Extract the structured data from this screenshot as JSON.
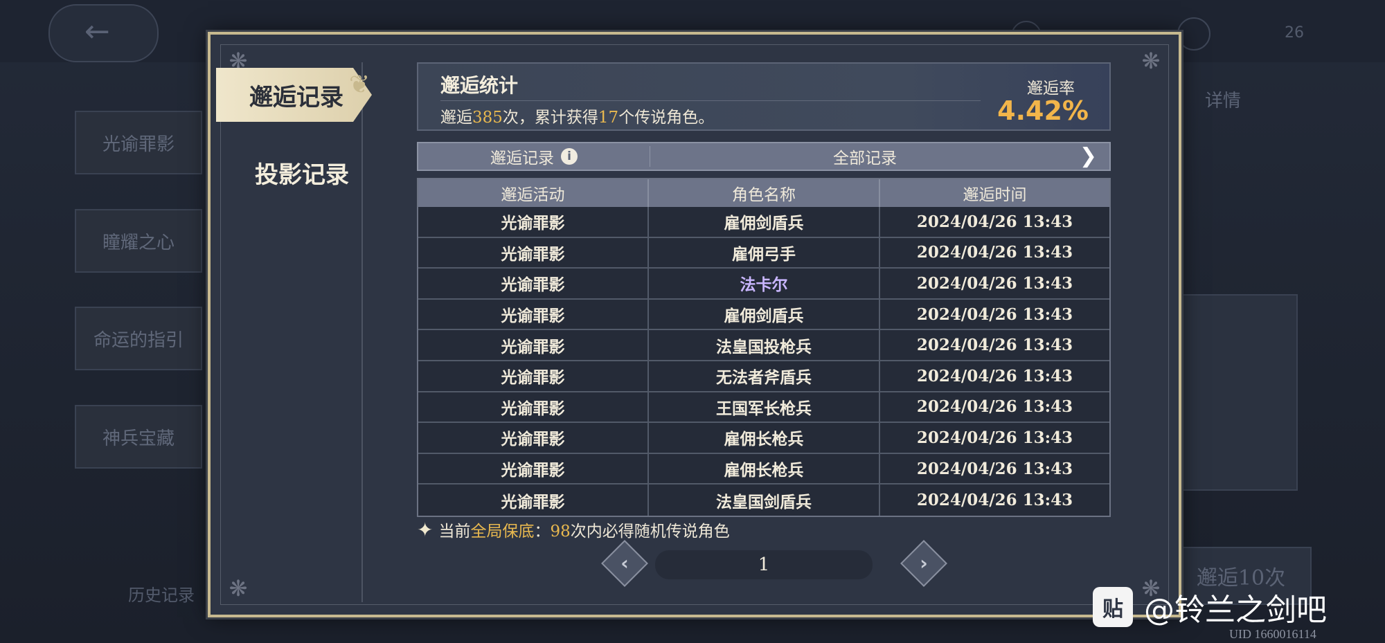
{
  "background": {
    "history_label": "历史记录",
    "detail_label": "详情",
    "pull_label": "邂逅10次",
    "counter": "26",
    "banner_tabs": [
      {
        "label": "光谕罪影"
      },
      {
        "label": "瞳耀之心"
      },
      {
        "label": "命运的指引"
      },
      {
        "label": "神兵宝藏"
      }
    ]
  },
  "nav": {
    "active_label": "邂逅记录",
    "second_label": "投影记录"
  },
  "stats": {
    "title": "邂逅统计",
    "desc_prefix": "邂逅",
    "pull_count": "385",
    "desc_mid": "次，累计获得",
    "legend_count": "17",
    "desc_suffix": "个传说角色。",
    "rate_label": "邂逅率",
    "rate_value": "4.42%"
  },
  "filter": {
    "left_label": "邂逅记录",
    "right_label": "全部记录"
  },
  "table": {
    "headers": [
      "邂逅活动",
      "角色名称",
      "邂逅时间"
    ],
    "rows": [
      {
        "event": "光谕罪影",
        "name": "雇佣剑盾兵",
        "time": "2024/04/26 13:43",
        "highlight": false
      },
      {
        "event": "光谕罪影",
        "name": "雇佣弓手",
        "time": "2024/04/26 13:43",
        "highlight": false
      },
      {
        "event": "光谕罪影",
        "name": "法卡尔",
        "time": "2024/04/26 13:43",
        "highlight": true
      },
      {
        "event": "光谕罪影",
        "name": "雇佣剑盾兵",
        "time": "2024/04/26 13:43",
        "highlight": false
      },
      {
        "event": "光谕罪影",
        "name": "法皇国投枪兵",
        "time": "2024/04/26 13:43",
        "highlight": false
      },
      {
        "event": "光谕罪影",
        "name": "无法者斧盾兵",
        "time": "2024/04/26 13:43",
        "highlight": false
      },
      {
        "event": "光谕罪影",
        "name": "王国军长枪兵",
        "time": "2024/04/26 13:43",
        "highlight": false
      },
      {
        "event": "光谕罪影",
        "name": "雇佣长枪兵",
        "time": "2024/04/26 13:43",
        "highlight": false
      },
      {
        "event": "光谕罪影",
        "name": "雇佣长枪兵",
        "time": "2024/04/26 13:43",
        "highlight": false
      },
      {
        "event": "光谕罪影",
        "name": "法皇国剑盾兵",
        "time": "2024/04/26 13:43",
        "highlight": false
      }
    ]
  },
  "pity": {
    "prefix": "当前",
    "highlight_label": "全局保底",
    "colon": "：",
    "count": "98",
    "suffix": "次内必得随机传说角色"
  },
  "pager": {
    "current_page": "1"
  },
  "watermark": {
    "logo_text": "贴",
    "text": "@铃兰之剑吧",
    "uid": "UID 1660016114"
  },
  "colors": {
    "gold": "#e9b94f",
    "highlight_name": "#c9b6ff",
    "frame": "#c7b98f"
  },
  "icons": {
    "info": "info-icon",
    "arrow_right": "chevron-right-icon",
    "spark": "four-point-star-icon",
    "prev": "chevron-left-icon",
    "next": "chevron-right-icon"
  }
}
